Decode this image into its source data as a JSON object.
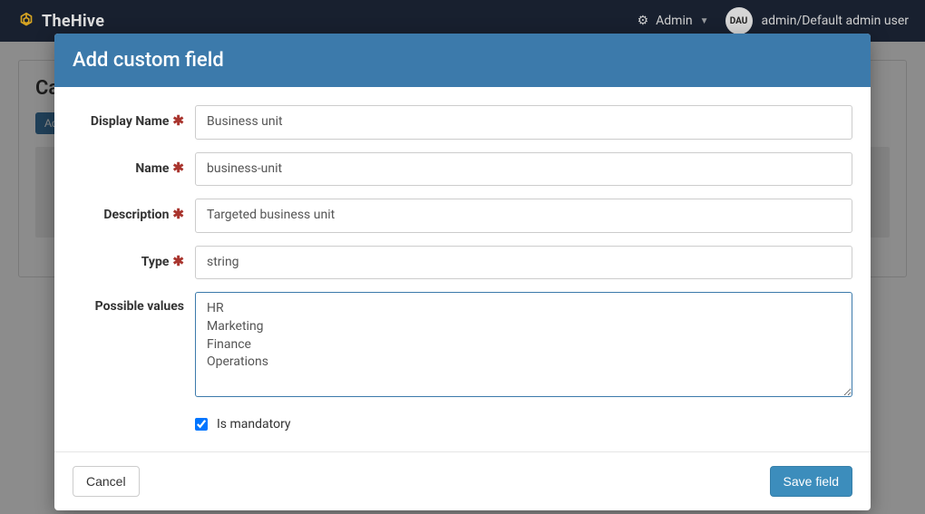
{
  "navbar": {
    "brand": "TheHive",
    "admin_label": "Admin",
    "avatar_initials": "DAU",
    "user_label": "admin/Default admin user"
  },
  "bg": {
    "panel_title": "Case",
    "add_button": "Add c"
  },
  "modal": {
    "title": "Add custom field",
    "labels": {
      "display_name": "Display Name",
      "name": "Name",
      "description": "Description",
      "type": "Type",
      "possible_values": "Possible values",
      "is_mandatory": "Is mandatory"
    },
    "values": {
      "display_name": "Business unit",
      "name": "business-unit",
      "description": "Targeted business unit",
      "type": "string",
      "possible_values": "HR\nMarketing\nFinance\nOperations",
      "is_mandatory_checked": true
    },
    "buttons": {
      "cancel": "Cancel",
      "save": "Save field"
    }
  }
}
